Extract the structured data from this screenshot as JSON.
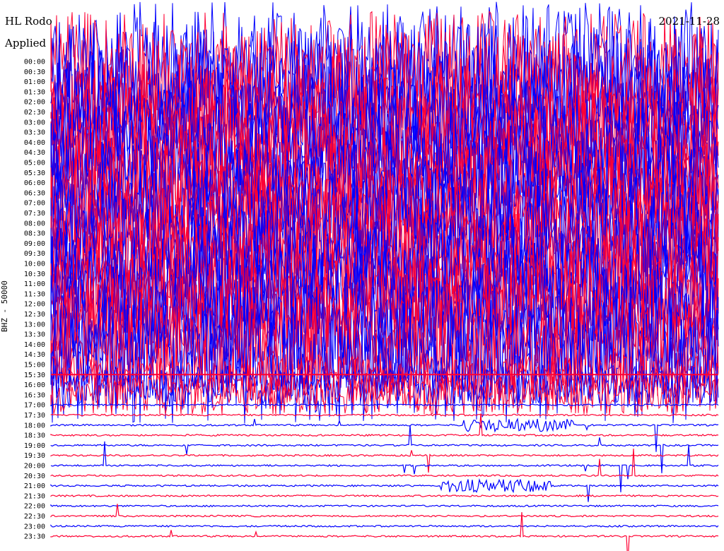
{
  "header": {
    "title_left": "HL Rodo",
    "subtitle_left": "Applied",
    "title_right": "2021-11-28"
  },
  "chart_data": {
    "type": "line",
    "plot_kind": "helicorder",
    "channel_label": "BHZ - 50000",
    "row_interval_minutes": 30,
    "time_labels": [
      "00:00",
      "00:30",
      "01:00",
      "01:30",
      "02:00",
      "02:30",
      "03:00",
      "03:30",
      "04:00",
      "04:30",
      "05:00",
      "05:30",
      "06:00",
      "06:30",
      "07:00",
      "07:30",
      "08:00",
      "08:30",
      "09:00",
      "09:30",
      "10:00",
      "10:30",
      "11:00",
      "11:30",
      "12:00",
      "12:30",
      "13:00",
      "13:30",
      "14:00",
      "14:30",
      "15:00",
      "15:30",
      "16:00",
      "16:30",
      "17:00",
      "17:30",
      "18:00",
      "18:30",
      "19:00",
      "19:30",
      "20:00",
      "20:30",
      "21:00",
      "21:30",
      "22:00",
      "22:30",
      "23:00",
      "23:30"
    ],
    "trace_colors": [
      "#ff0033",
      "#0000ff"
    ],
    "amplitude_pattern": {
      "saturated_rows": "00:00-15:30",
      "quiet_rows": "17:00-23:30",
      "events": [
        {
          "row": "18:00",
          "minute": 21
        },
        {
          "row": "21:00",
          "minute": 20
        }
      ]
    }
  }
}
